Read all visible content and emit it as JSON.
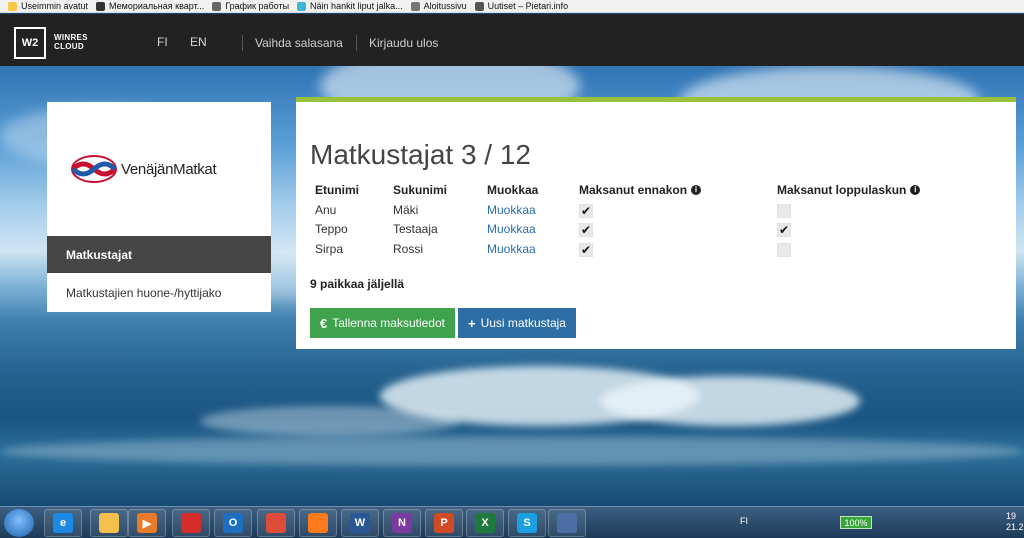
{
  "bookmarks": [
    {
      "label": "Useimmin avatut",
      "color": "#f6c64a"
    },
    {
      "label": "Мемориальная кварт...",
      "color": "#333333"
    },
    {
      "label": "График работы",
      "color": "#666666"
    },
    {
      "label": "Näin hankit liput jalka...",
      "color": "#3fb5d6"
    },
    {
      "label": "Aloitussivu",
      "color": "#777777"
    },
    {
      "label": "Uutiset – Pietari.info",
      "color": "#555555"
    }
  ],
  "header": {
    "logo_mark": "W2",
    "logo_line1": "WINRES",
    "logo_line2": "CLOUD",
    "lang_fi": "FI",
    "lang_en": "EN",
    "change_password": "Vaihda salasana",
    "logout": "Kirjaudu ulos"
  },
  "sidebar": {
    "brand": "VenäjänMatkat",
    "items": [
      {
        "label": "Matkustajat",
        "active": true
      },
      {
        "label": "Matkustajien huone-/hyttijako",
        "active": false
      }
    ]
  },
  "main": {
    "title": "Matkustajat 3 / 12",
    "columns": {
      "first": "Etunimi",
      "last": "Sukunimi",
      "edit": "Muokkaa",
      "prepaid": "Maksanut ennakon",
      "final": "Maksanut loppulaskun"
    },
    "rows": [
      {
        "first": "Anu",
        "last": "Mäki",
        "edit": "Muokkaa",
        "prepaid": true,
        "final": false
      },
      {
        "first": "Teppo",
        "last": "Testaaja",
        "edit": "Muokkaa",
        "prepaid": true,
        "final": true
      },
      {
        "first": "Sirpa",
        "last": "Rossi",
        "edit": "Muokkaa",
        "prepaid": true,
        "final": false
      }
    ],
    "remaining": "9 paikkaa jäljellä",
    "save_button": "Tallenna maksutiedot",
    "save_glyph": "€",
    "new_button": "Uusi matkustaja",
    "new_glyph": "+"
  },
  "taskbar": {
    "apps": [
      "start-orb",
      "internet-explorer",
      "file-explorer",
      "media-player",
      "app-red",
      "outlook",
      "chrome",
      "firefox",
      "word",
      "onenote",
      "powerpoint",
      "excel",
      "skype",
      "network-app"
    ],
    "app_glyphs": [
      "",
      "e",
      "",
      "▶",
      "",
      "O",
      "",
      "",
      "W",
      "N",
      "P",
      "X",
      "S",
      ""
    ],
    "app_colors": [
      "#3a8ad8",
      "#1e88e5",
      "#f2c04b",
      "#e87b2a",
      "#d42b2b",
      "#1e6fc1",
      "#dd4b39",
      "#ff7a1a",
      "#2b5797",
      "#7a3aa0",
      "#d04a26",
      "#1e7a3c",
      "#1aa0e0",
      "#4a6fa5"
    ],
    "lang": "FI",
    "battery": "100%",
    "time": "19",
    "date": "21.2"
  }
}
